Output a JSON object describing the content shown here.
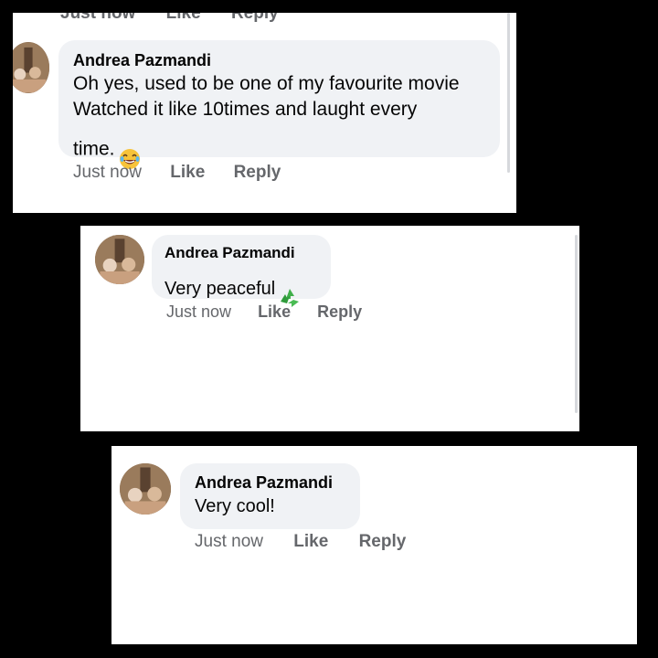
{
  "comments": [
    {
      "author": "Andrea Pazmandi",
      "text": "Oh yes, used to be one of my favourite movie\n Watched it like 10times and laught every\ntime.",
      "emoji": "laughing-tears-emoji",
      "time": "Just now",
      "like_label": "Like",
      "reply_label": "Reply",
      "cut_time": "Just now",
      "cut_like": "Like",
      "cut_reply": "Reply"
    },
    {
      "author": "Andrea Pazmandi",
      "text": "Very peaceful",
      "emoji": "recycle-arrows-emoji",
      "time": "Just now",
      "like_label": "Like",
      "reply_label": "Reply"
    },
    {
      "author": "Andrea Pazmandi",
      "text": "Very cool!",
      "time": "Just now",
      "like_label": "Like",
      "reply_label": "Reply"
    }
  ],
  "colors": {
    "bubble": "#f0f2f5",
    "meta_text": "#65676b",
    "name_text": "#050505",
    "background": "#000000"
  }
}
